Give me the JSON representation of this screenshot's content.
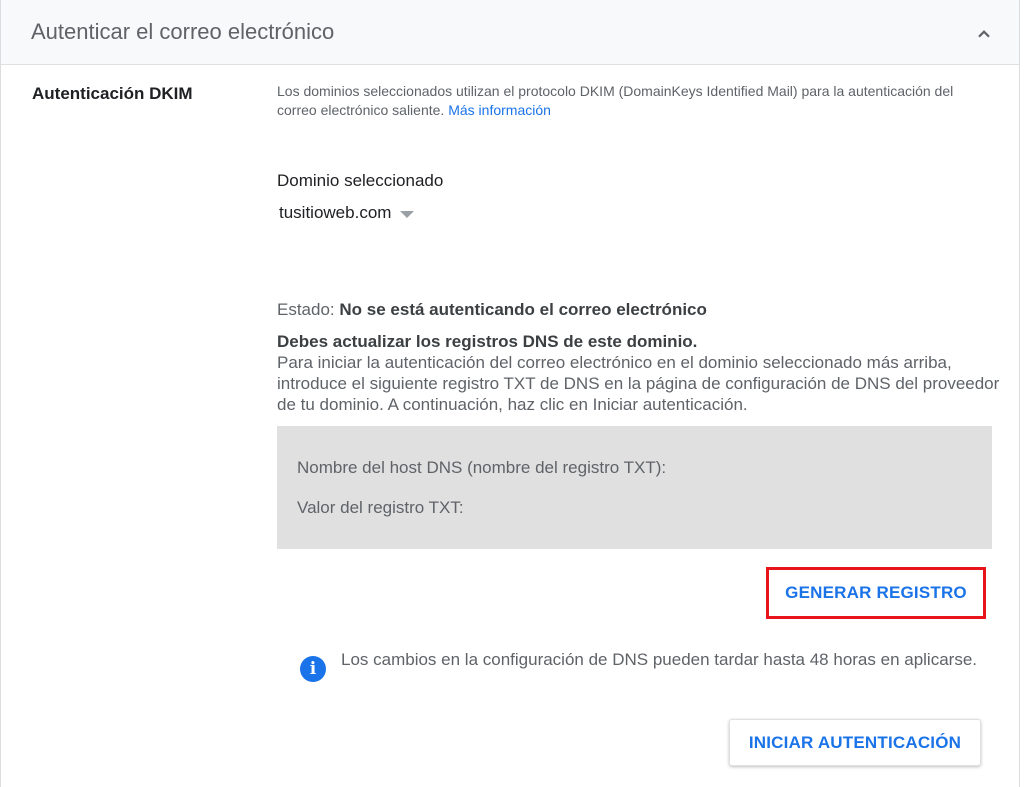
{
  "header": {
    "title": "Autenticar el correo electrónico",
    "collapse_icon": "chevron-up-icon"
  },
  "section": {
    "label": "Autenticación DKIM",
    "description": "Los dominios seleccionados utilizan el protocolo DKIM (DomainKeys Identified Mail) para la autenticación del correo electrónico saliente.",
    "more_info_link": "Más información"
  },
  "domain": {
    "label": "Dominio seleccionado",
    "selected": "tusitioweb.com"
  },
  "status": {
    "prefix": "Estado:",
    "value": "No se está autenticando el correo electrónico"
  },
  "notice": {
    "heading": "Debes actualizar los registros DNS de este dominio.",
    "body": "Para iniciar la autenticación del correo electrónico en el dominio seleccionado más arriba, introduce el siguiente registro TXT de DNS en la página de configuración de DNS del proveedor de tu dominio. A continuación, haz clic en Iniciar autenticación."
  },
  "dns_record": {
    "host_label": "Nombre del host DNS (nombre del registro TXT):",
    "value_label": "Valor del registro TXT:"
  },
  "buttons": {
    "generate": "GENERAR REGISTRO",
    "start": "INICIAR AUTENTICACIÓN"
  },
  "info": {
    "icon": "info-icon",
    "text": "Los cambios en la configuración de DNS pueden tardar hasta 48 horas en aplicarse."
  },
  "colors": {
    "accent": "#1a73e8",
    "highlight_border": "#e8141c",
    "dns_box_bg": "#e0e0e0"
  }
}
